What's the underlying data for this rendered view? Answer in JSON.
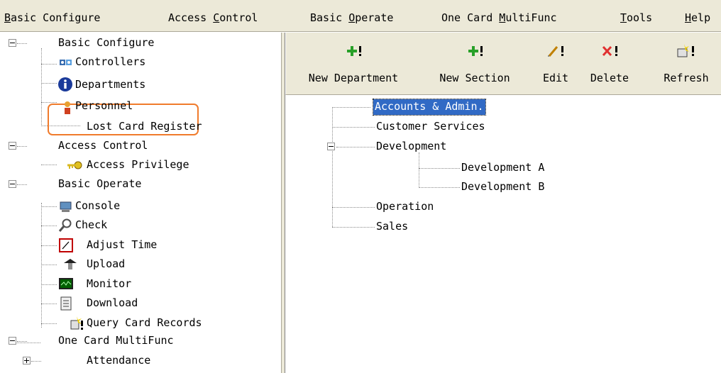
{
  "menu": [
    {
      "pre": "",
      "mn": "B",
      "post": "asic Configure"
    },
    {
      "pre": "Access ",
      "mn": "C",
      "post": "ontrol"
    },
    {
      "pre": "Basic ",
      "mn": "O",
      "post": "perate"
    },
    {
      "pre": "One Card ",
      "mn": "M",
      "post": "ultiFunc"
    },
    {
      "pre": "",
      "mn": "T",
      "post": "ools"
    },
    {
      "pre": "",
      "mn": "H",
      "post": "elp"
    }
  ],
  "nav_tree": {
    "basic_configure": "Basic Configure",
    "controllers": "Controllers",
    "departments": "Departments",
    "personnel": "Personnel",
    "lost_card_register": "Lost Card Register",
    "access_control": "Access Control",
    "access_privilege": "Access Privilege",
    "basic_operate": "Basic Operate",
    "console": "Console",
    "check": "Check",
    "adjust_time": "Adjust Time",
    "upload": "Upload",
    "monitor": "Monitor",
    "download": "Download",
    "query_card_records": "Query Card Records",
    "one_card_multifunc": "One Card MultiFunc",
    "attendance": "Attendance"
  },
  "toolbar": {
    "new_department": "New Department",
    "new_section": "New Section",
    "edit": "Edit",
    "delete": "Delete",
    "refresh": "Refresh"
  },
  "dept_tree": {
    "accounts_admin": "Accounts & Admin.",
    "customer_services": "Customer Services",
    "development": "Development",
    "development_a": "Development A",
    "development_b": "Development B",
    "operation": "Operation",
    "sales": "Sales"
  },
  "colors": {
    "highlight_outline": "#f07b2c",
    "selection": "#316ac5",
    "chrome": "#ece9d8"
  }
}
